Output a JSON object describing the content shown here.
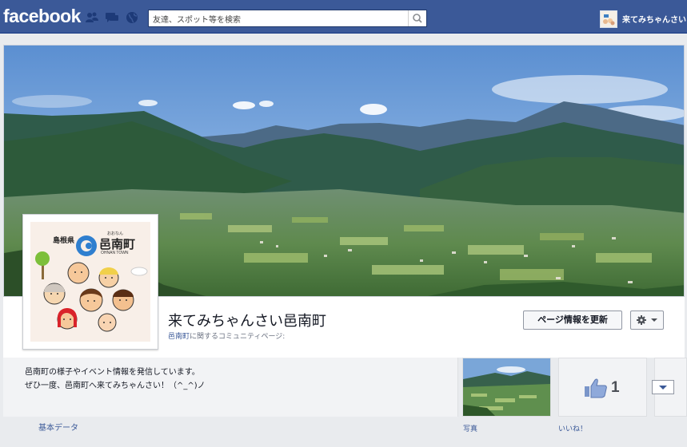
{
  "topbar": {
    "logo": "facebook",
    "icons": [
      "friend-requests-icon",
      "messages-icon",
      "notifications-globe-icon"
    ],
    "search_placeholder": "友達、スポット等を検索",
    "user_name": "来てみちゃんさい"
  },
  "colors": {
    "brand_blue": "#3b5998",
    "link_blue": "#3b5998",
    "panel_gray": "#f2f3f5"
  },
  "page": {
    "title": "来てみちゃんさい邑南町",
    "subtitle_link": "邑南町",
    "subtitle_rest": "に関するコミュニティページ:",
    "update_button": "ページ情報を更新",
    "profile_logo": {
      "prefecture": "島根県",
      "town": "邑南町",
      "reading": "おおなん",
      "romaji": "OHNAN TOWN"
    }
  },
  "about": {
    "line1": "邑南町の様子やイベント情報を発信しています。",
    "line2": "ぜひ一度、邑南町へ来てみちゃんさい！（^_^)ノ"
  },
  "tabs": {
    "basic_data": "基本データ",
    "photos": "写真",
    "likes": "いいね！",
    "likes_count": "1"
  }
}
